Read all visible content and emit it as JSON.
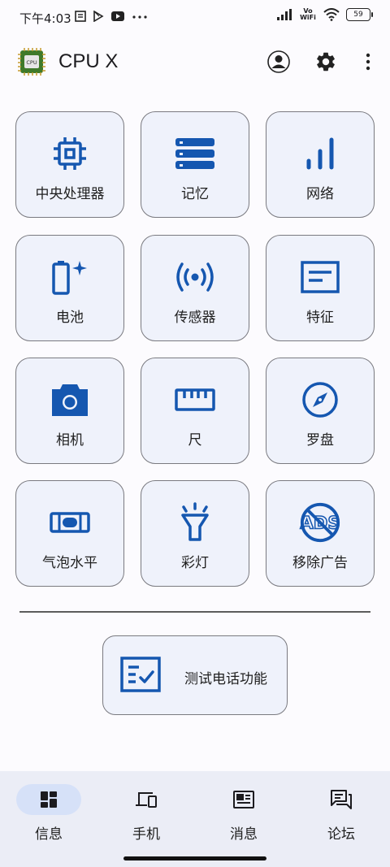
{
  "status_bar": {
    "time": "下午4:03",
    "network_label": "Vo WiFi",
    "battery": "59"
  },
  "app": {
    "title": "CPU X",
    "logo_text": "CPU"
  },
  "colors": {
    "accent": "#1557b0",
    "tile_bg": "#eff2fb",
    "nav_bg": "#ebedf6"
  },
  "grid": [
    {
      "label": "中央处理器",
      "icon": "cpu-chip-icon"
    },
    {
      "label": "记忆",
      "icon": "memory-stack-icon"
    },
    {
      "label": "网络",
      "icon": "signal-bars-icon"
    },
    {
      "label": "电池",
      "icon": "battery-icon"
    },
    {
      "label": "传感器",
      "icon": "sensor-waves-icon"
    },
    {
      "label": "特征",
      "icon": "feature-card-icon"
    },
    {
      "label": "相机",
      "icon": "camera-icon"
    },
    {
      "label": "尺",
      "icon": "ruler-icon"
    },
    {
      "label": "罗盘",
      "icon": "compass-icon"
    },
    {
      "label": "气泡水平",
      "icon": "bubble-level-icon"
    },
    {
      "label": "彩灯",
      "icon": "flashlight-icon"
    },
    {
      "label": "移除广告",
      "icon": "no-ads-icon"
    }
  ],
  "test_phone": {
    "label": "测试电话功能",
    "icon": "checklist-icon"
  },
  "bottom_nav": [
    {
      "label": "信息",
      "icon": "dashboard-icon",
      "active": true
    },
    {
      "label": "手机",
      "icon": "devices-icon",
      "active": false
    },
    {
      "label": "消息",
      "icon": "newspaper-icon",
      "active": false
    },
    {
      "label": "论坛",
      "icon": "forum-icon",
      "active": false
    }
  ]
}
